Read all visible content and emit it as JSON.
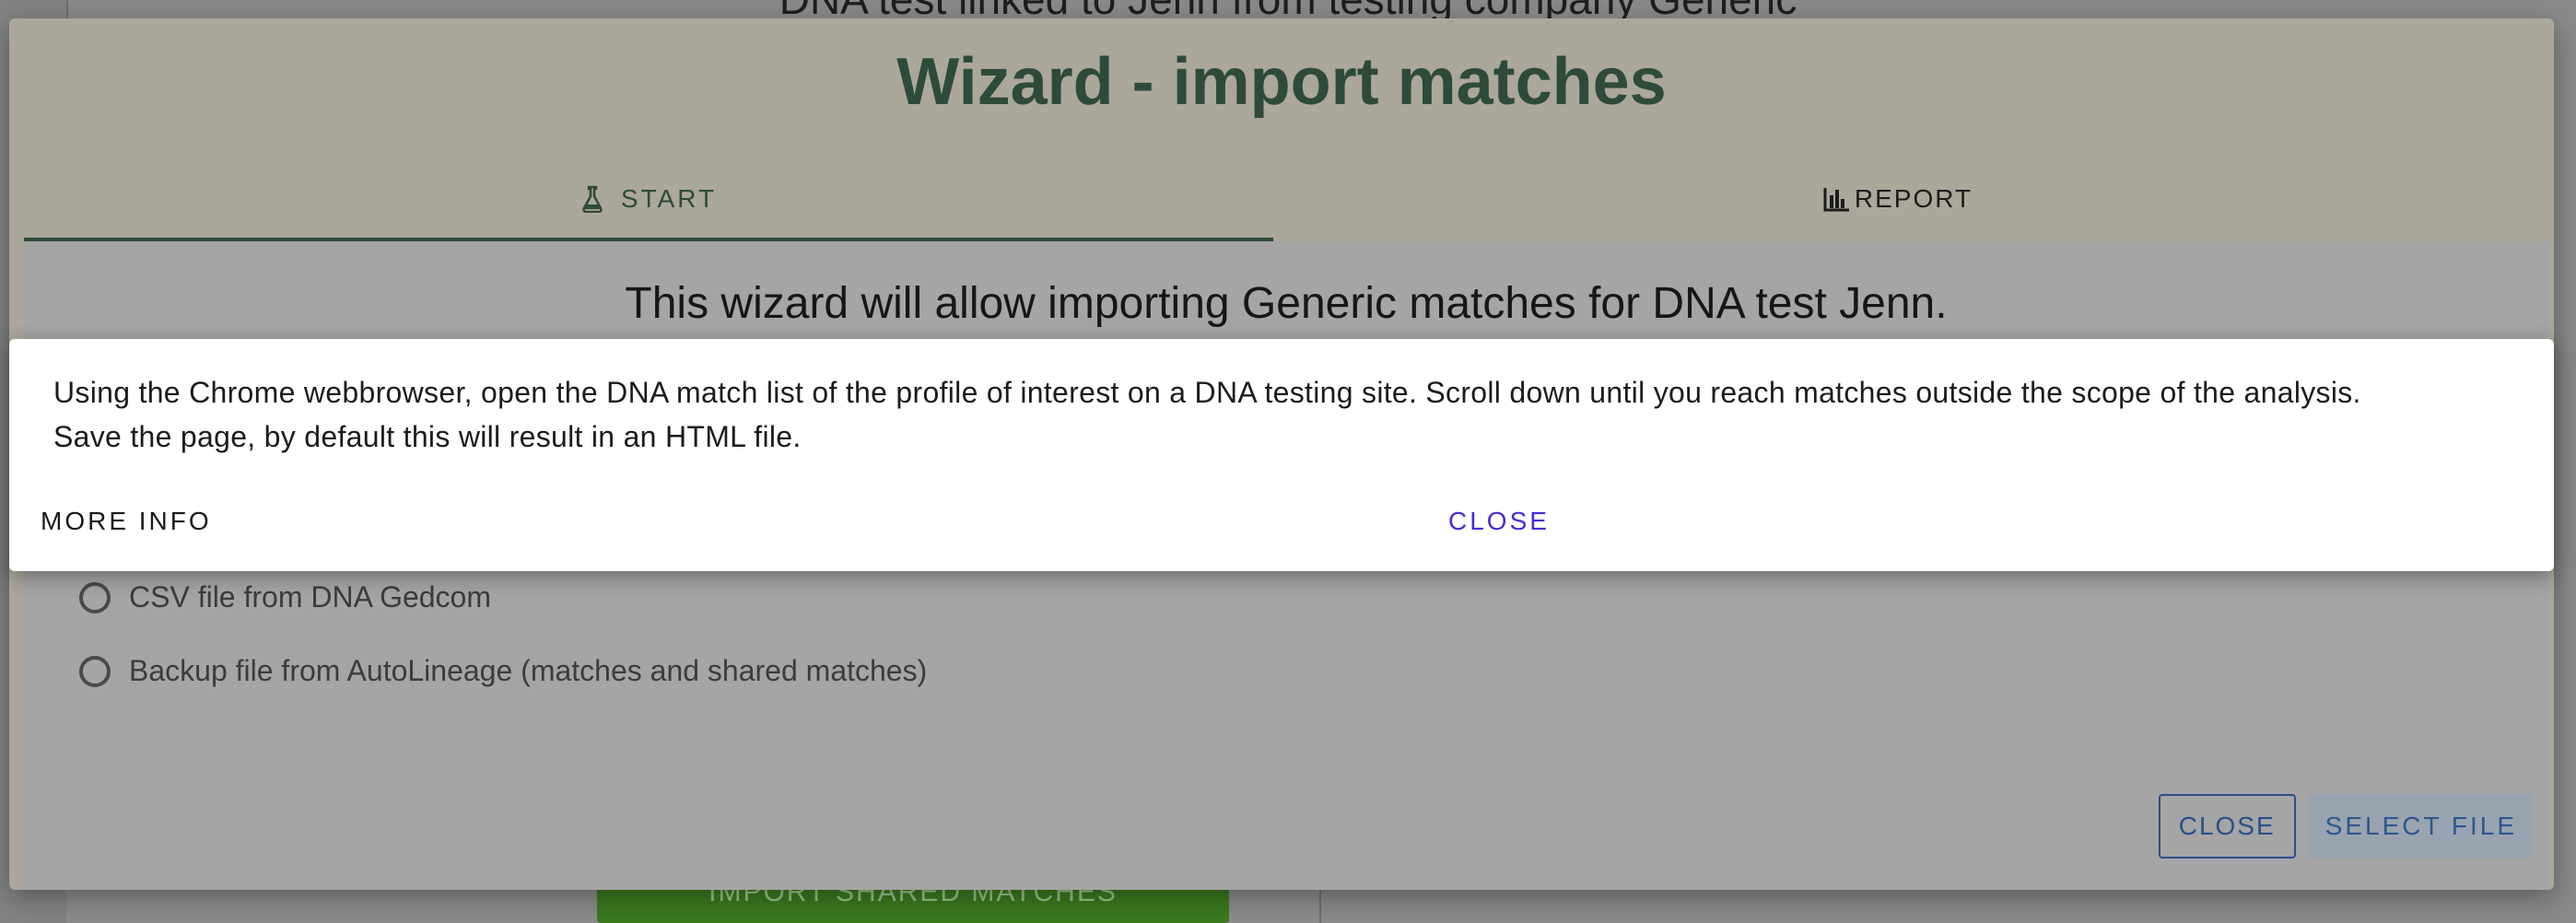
{
  "background": {
    "heading": "DNA test linked to Jenn from testing company Generic",
    "import_button_label": "IMPORT SHARED MATCHES"
  },
  "wizard": {
    "title": "Wizard - import matches",
    "tabs": [
      {
        "label": "START",
        "icon": "flask-icon",
        "selected": true
      },
      {
        "label": "REPORT",
        "icon": "bar-chart-icon",
        "selected": false
      }
    ],
    "intro": "This wizard will allow importing Generic matches for DNA test Jenn.",
    "options": [
      {
        "label": "CSV file from DNA Gedcom",
        "selected": false
      },
      {
        "label": "Backup file from AutoLineage (matches and shared matches)",
        "selected": false
      }
    ],
    "actions": {
      "close_label": "CLOSE",
      "select_file_label": "SELECT FILE"
    }
  },
  "info_popup": {
    "line1": "Using the Chrome webbrowser, open the DNA match list of the profile of interest on a DNA testing site. Scroll down until you reach matches outside the scope of the analysis.",
    "line2": "Save the page, by default this will result in an HTML file.",
    "more_info_label": "MORE INFO",
    "close_label": "CLOSE"
  },
  "colors": {
    "title": "#2e4a3a",
    "accent": "#4b2ad6",
    "button_blue": "#2b4e8a",
    "import_button": "#3b7a1f"
  }
}
